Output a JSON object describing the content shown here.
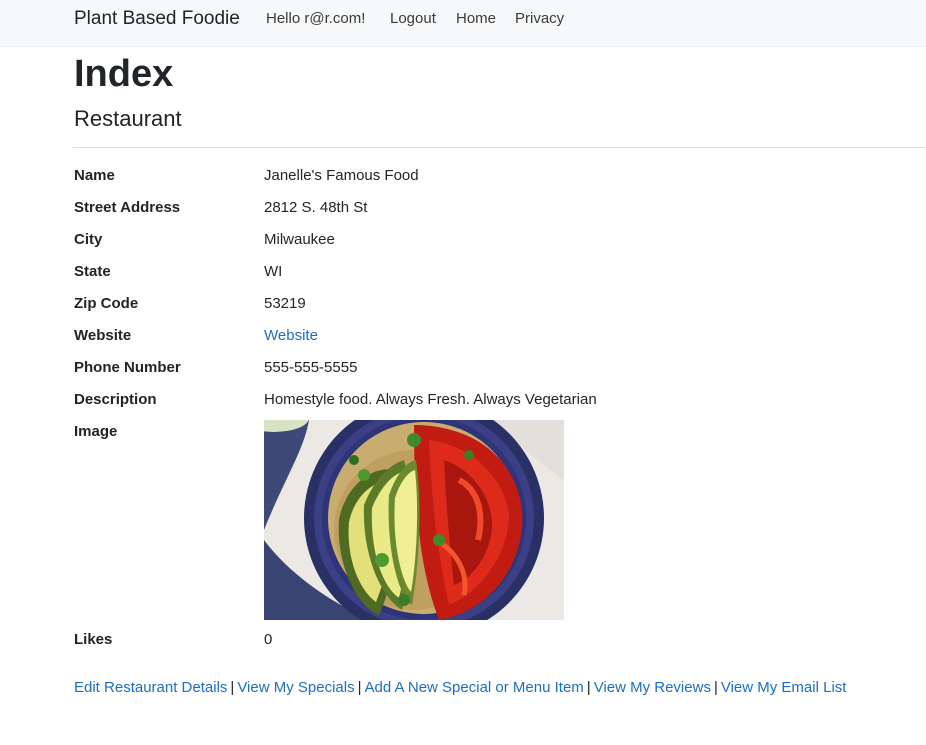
{
  "navbar": {
    "brand": "Plant Based Foodie",
    "hello": "Hello r@r.com!",
    "logout": "Logout",
    "home": "Home",
    "privacy": "Privacy"
  },
  "page": {
    "title": "Index",
    "subtitle": "Restaurant"
  },
  "details": [
    {
      "label": "Name",
      "value": "Janelle's Famous Food"
    },
    {
      "label": "Street Address",
      "value": "2812 S. 48th St"
    },
    {
      "label": "City",
      "value": "Milwaukee"
    },
    {
      "label": "State",
      "value": "WI"
    },
    {
      "label": "Zip Code",
      "value": "53219"
    },
    {
      "label": "Website",
      "value": "Website"
    },
    {
      "label": "Phone Number",
      "value": "555-555-5555"
    },
    {
      "label": "Description",
      "value": "Homestyle food. Always Fresh. Always Vegetarian"
    },
    {
      "label": "Image"
    },
    {
      "label": "Likes",
      "value": "0"
    }
  ],
  "actions": {
    "edit": "Edit Restaurant Details",
    "specials": "View My Specials",
    "add_special": "Add A New Special or Menu Item",
    "reviews": "View My Reviews",
    "email_list": "View My Email List",
    "separator": "|"
  },
  "colors": {
    "link": "#1b6ec2",
    "navbar_bg": "#f8f9fa",
    "text": "#212529"
  }
}
